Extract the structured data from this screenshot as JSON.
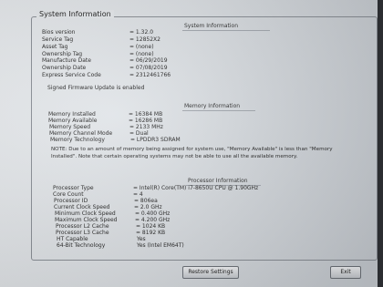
{
  "header": {
    "title": "System Information"
  },
  "system": {
    "title": "System Information",
    "rows": [
      {
        "label": "Bios version",
        "value": "= 1.32.0"
      },
      {
        "label": "Service Tag",
        "value": "= 12852X2"
      },
      {
        "label": "Asset Tag",
        "value": "= (none)"
      },
      {
        "label": "Ownership Tag",
        "value": "= (none)"
      },
      {
        "label": "Manufacture Date",
        "value": "= 06/29/2019"
      },
      {
        "label": "Ownership Date",
        "value": "= 07/08/2019"
      },
      {
        "label": "Express Service Code",
        "value": "= 2312461766"
      }
    ],
    "signed_text": "Signed Firmware Update is enabled"
  },
  "memory": {
    "title": "Memory Information",
    "rows": [
      {
        "label": "Memory Installed",
        "value": "= 16384 MB"
      },
      {
        "label": "Memory Available",
        "value": "= 16286 MB"
      },
      {
        "label": "Memory Speed",
        "value": "= 2133 MHz"
      },
      {
        "label": "Memory Channel Mode",
        "value": "= Dual"
      },
      {
        "label": "Memory Technology",
        "value": "= LPDDR3 SDRAM"
      }
    ],
    "note": "NOTE: Due to an amount of memory being assigned for system use, \"Memory Available\" is less than \"Memory Installed\". Note that certain operating systems may not be able to use all the available memory."
  },
  "processor": {
    "title": "Processor Information",
    "rows": [
      {
        "label": "Processor Type",
        "value": "= Intel(R) Core(TM) i7-8650U CPU @ 1.90GHz"
      },
      {
        "label": "Core Count",
        "value": "= 4"
      },
      {
        "label": "Processor ID",
        "value": "= 806ea"
      },
      {
        "label": "Current Clock Speed",
        "value": "= 2.0 GHz"
      },
      {
        "label": "Minimum Clock Speed",
        "value": "= 0.400 GHz"
      },
      {
        "label": "Maximum Clock Speed",
        "value": "= 4.200 GHz"
      },
      {
        "label": "Processor L2 Cache",
        "value": "= 1024 KB"
      },
      {
        "label": "Processor L3 Cache",
        "value": "= 8192 KB"
      },
      {
        "label": "HT Capable",
        "value": "Yes"
      },
      {
        "label": "64-Bit Technology",
        "value": "Yes (Intel EM64T)"
      }
    ]
  },
  "buttons": {
    "restore": "Restore Settings",
    "exit": "Exit"
  }
}
